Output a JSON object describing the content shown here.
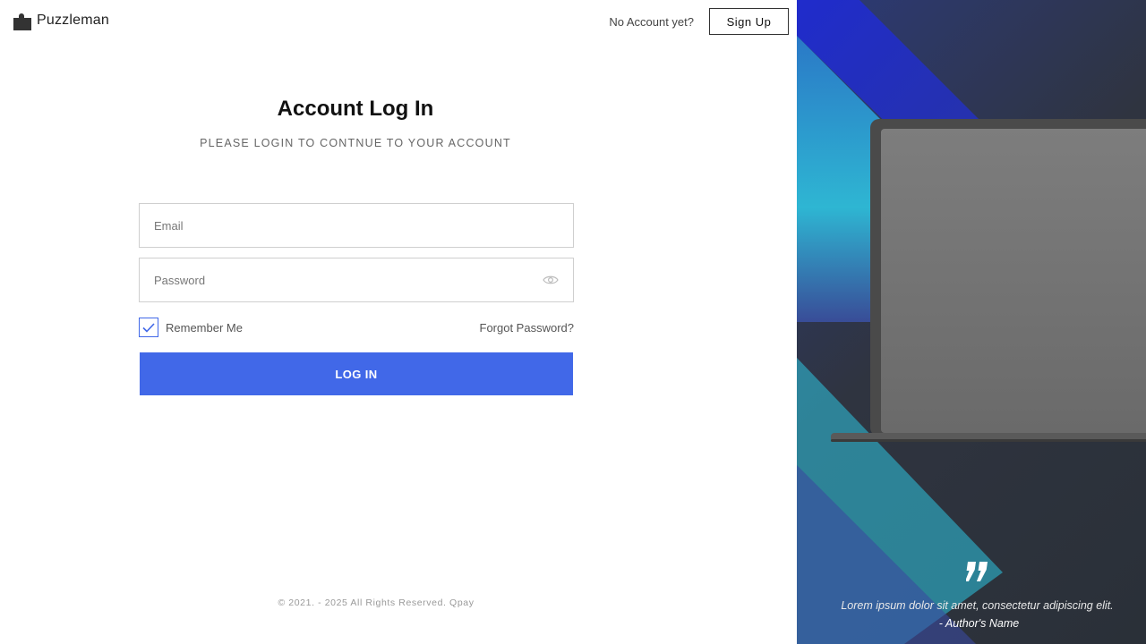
{
  "brand": {
    "name": "Puzzleman",
    "icon": "puzzle-piece-icon"
  },
  "header": {
    "no_account_text": "No Account yet?",
    "signup_label": "Sign Up"
  },
  "login": {
    "title": "Account Log In",
    "subtitle": "PLEASE LOGIN TO CONTNUE TO YOUR ACCOUNT",
    "email": {
      "placeholder": "Email",
      "value": ""
    },
    "password": {
      "placeholder": "Password",
      "value": ""
    },
    "remember_label": "Remember Me",
    "remember_checked": true,
    "forgot_label": "Forgot Password?",
    "submit_label": "LOG IN"
  },
  "footer": {
    "copyright": "© 2021. - 2025 All Rights Reserved. Qpay"
  },
  "testimonial": {
    "quote": "Lorem ipsum dolor sit amet, consectetur adipiscing elit.",
    "author": "- Author's Name"
  },
  "colors": {
    "accent": "#4168e8",
    "panel_dark": "#2f3440",
    "panel_blue": "#2233bb",
    "panel_cyan": "#2ec4e0"
  }
}
